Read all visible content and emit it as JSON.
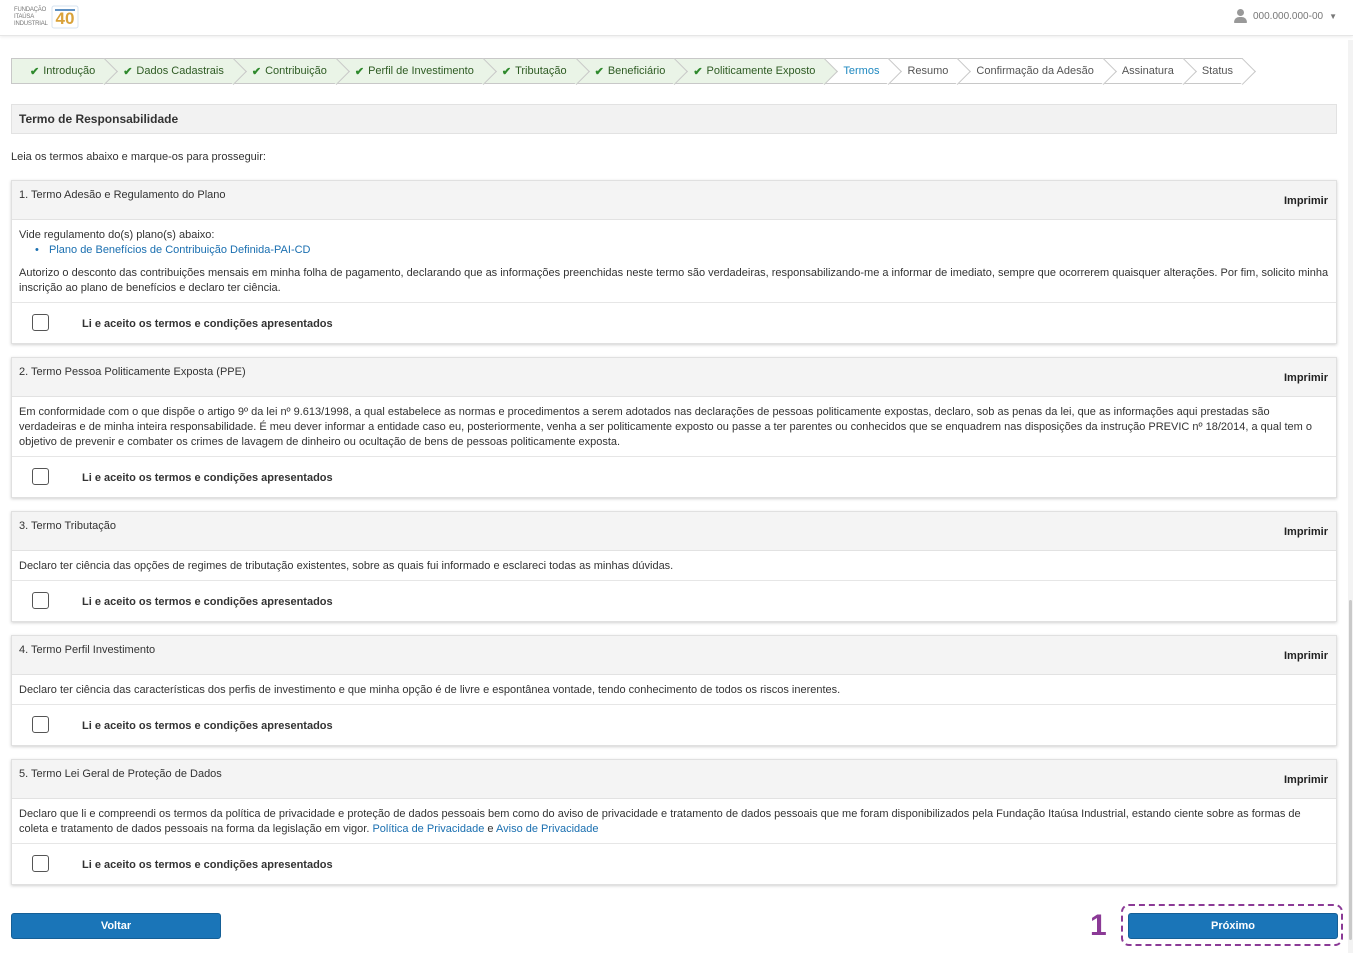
{
  "header": {
    "logo_text_lines": [
      "FUNDAÇÃO",
      "ITAÚSA",
      "INDUSTRIAL"
    ],
    "logo_badge": "40",
    "user_id": "000.000.000-00"
  },
  "steps": [
    {
      "label": "Introdução",
      "state": "done"
    },
    {
      "label": "Dados Cadastrais",
      "state": "done"
    },
    {
      "label": "Contribuição",
      "state": "done"
    },
    {
      "label": "Perfil de Investimento",
      "state": "done"
    },
    {
      "label": "Tributação",
      "state": "done"
    },
    {
      "label": "Beneficiário",
      "state": "done"
    },
    {
      "label": "Politicamente Exposto",
      "state": "done"
    },
    {
      "label": "Termos",
      "state": "active"
    },
    {
      "label": "Resumo",
      "state": "pending"
    },
    {
      "label": "Confirmação da Adesão",
      "state": "pending"
    },
    {
      "label": "Assinatura",
      "state": "pending"
    },
    {
      "label": "Status",
      "state": "pending"
    }
  ],
  "section": {
    "title": "Termo de Responsabilidade",
    "intro": "Leia os termos abaixo e marque-os para prosseguir:"
  },
  "print_label": "Imprimir",
  "accept_label": "Li e aceito os termos e condições apresentados",
  "terms": [
    {
      "title": "1. Termo Adesão e Regulamento do Plano",
      "pre": "Vide regulamento do(s) plano(s) abaixo:",
      "plan_link": "Plano de Benefícios de Contribuição Definida-PAI-CD",
      "text": "Autorizo o desconto das contribuições mensais em minha folha de pagamento, declarando que as informações preenchidas neste termo são verdadeiras, responsabilizando-me a informar de imediato, sempre que ocorrerem quaisquer alterações. Por fim, solicito minha inscrição ao plano de benefícios e declaro ter ciência."
    },
    {
      "title": "2. Termo Pessoa Politicamente Exposta (PPE)",
      "text": "Em conformidade com o que dispõe o artigo 9º da lei nº 9.613/1998, a qual estabelece as normas e procedimentos a serem adotados nas declarações de pessoas politicamente expostas, declaro, sob as penas da lei, que as informações aqui prestadas são verdadeiras e de minha inteira responsabilidade. É meu dever informar a entidade caso eu, posteriormente, venha a ser politicamente exposto ou passe a ter parentes ou conhecidos que se enquadrem nas disposições da instrução PREVIC nº 18/2014, a qual tem o objetivo de prevenir e combater os crimes de lavagem de dinheiro ou ocultação de bens de pessoas politicamente exposta."
    },
    {
      "title": "3. Termo Tributação",
      "text": "Declaro ter ciência das opções de regimes de tributação existentes, sobre as quais fui informado e esclareci todas as minhas dúvidas."
    },
    {
      "title": "4. Termo Perfil Investimento",
      "text": "Declaro ter ciência das características dos perfis de investimento e que minha opção é de livre e espontânea vontade, tendo conhecimento de todos os riscos inerentes."
    },
    {
      "title": "5. Termo Lei Geral de Proteção de Dados",
      "text": "Declaro que li e compreendi os termos da política de privacidade e proteção de dados pessoais bem como do aviso de privacidade e tratamento de dados pessoais que me foram disponibilizados pela Fundação Itaúsa Industrial, estando ciente sobre as formas de coleta e tratamento de dados pessoais na forma da legislação em vigor.",
      "link1": "Política de Privacidade",
      "conj": "e",
      "link2": "Aviso de Privacidade"
    }
  ],
  "buttons": {
    "back": "Voltar",
    "next": "Próximo"
  },
  "annotation": {
    "number": "1",
    "color": "#8b3a96"
  },
  "colors": {
    "primary": "#1a75b8",
    "step_done_bg": "#eaf4e7",
    "step_done_check": "#2f8a2d",
    "step_active_text": "#1e88c0",
    "link": "#1a6fb0"
  }
}
